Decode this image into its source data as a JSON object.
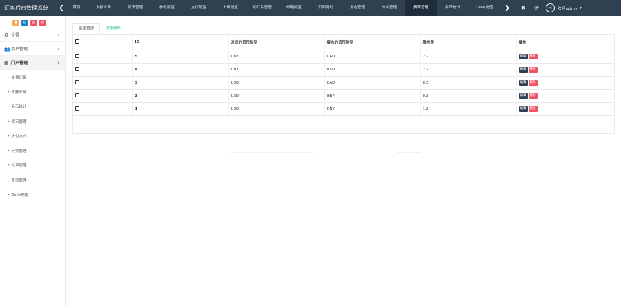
{
  "header": {
    "title": "汇率后台管理系统",
    "nav_items": [
      {
        "label": "首页",
        "active": false
      },
      {
        "label": "大额业务",
        "active": false
      },
      {
        "label": "货币管理",
        "active": false
      },
      {
        "label": "参数配置",
        "active": false
      },
      {
        "label": "支付配置",
        "active": false
      },
      {
        "label": "上传设置",
        "active": false
      },
      {
        "label": "幻灯片管理",
        "active": false
      },
      {
        "label": "邮箱配置",
        "active": false
      },
      {
        "label": "页面调动",
        "active": false
      },
      {
        "label": "角色管理",
        "active": false
      },
      {
        "label": "分类管理",
        "active": false
      },
      {
        "label": "费率管理",
        "active": true
      },
      {
        "label": "会币统计",
        "active": false
      },
      {
        "label": "Zelle充值",
        "active": false
      }
    ],
    "welcome": "欢迎 admin",
    "icons": [
      "chevron-left-icon",
      "chevron-right-icon",
      "close-icon",
      "refresh-icon",
      "share-icon",
      "caret-down-icon"
    ]
  },
  "sidebar": {
    "quick_buttons": [
      {
        "icon": "bar-chart-icon",
        "color": "#f8ac59"
      },
      {
        "icon": "document-icon",
        "color": "#1c84c6"
      },
      {
        "icon": "trash-icon",
        "color": "#ed5565"
      },
      {
        "icon": "settings-icon",
        "color": "#ed5565"
      }
    ],
    "menu": [
      {
        "label": "设置",
        "icon": "gears-icon",
        "open": false
      },
      {
        "label": "用户管理",
        "icon": "users-icon",
        "open": false
      },
      {
        "label": "门户管理",
        "icon": "grid-icon",
        "open": true
      }
    ],
    "sub_items": [
      "交易记录",
      "大额业务",
      "会币统计",
      "货币管理",
      "支付方式",
      "分类管理",
      "文章管理",
      "费率管理",
      "Zelle充值"
    ]
  },
  "content": {
    "tabs": [
      {
        "label": "费率管理",
        "active": true
      },
      {
        "label": "添加费率",
        "active": false
      }
    ],
    "table": {
      "headers": [
        "ID",
        "发送的货币类型",
        "接收的货币类型",
        "服务费",
        "操作"
      ],
      "rows": [
        {
          "id": "5",
          "send": "CNY",
          "recv": "CAD",
          "fee": "2.2"
        },
        {
          "id": "4",
          "send": "CNY",
          "recv": "USD",
          "fee": "2.2"
        },
        {
          "id": "3",
          "send": "USD",
          "recv": "CAD",
          "fee": "0.3"
        },
        {
          "id": "2",
          "send": "USD",
          "recv": "GBP",
          "fee": "0.2"
        },
        {
          "id": "1",
          "send": "USD",
          "recv": "CNY",
          "fee": "1.2"
        }
      ],
      "edit_label": "编辑",
      "delete_label": "删除"
    }
  },
  "colors": {
    "topbar": "#2f4050",
    "accent": "#1ab394",
    "danger": "#ed5565"
  }
}
